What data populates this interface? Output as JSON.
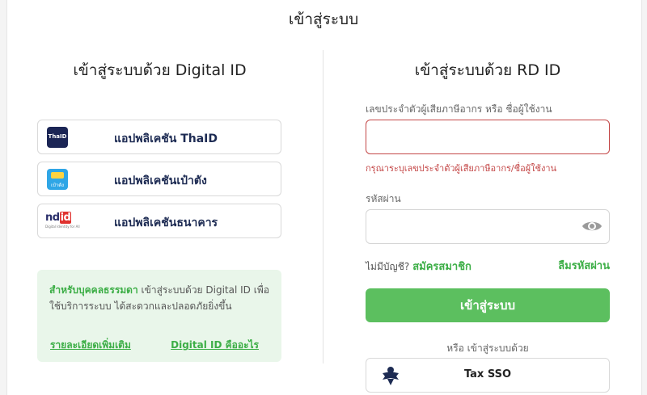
{
  "page": {
    "title": "เข้าสู่ระบบ"
  },
  "digital_id": {
    "title": "เข้าสู่ระบบด้วย Digital ID",
    "apps": [
      {
        "label": "แอปพลิเคชัน ThaID",
        "logo_text": "ThaID",
        "icon": "thaid-logo"
      },
      {
        "label": "แอปพลิเคชันเป๋าตัง",
        "logo_text": "เป๋าตัง",
        "icon": "paotang-logo"
      },
      {
        "label": "แอปพลิเคชันธนาคาร",
        "logo_text_a": "nd",
        "logo_text_b": "id",
        "logo_sub": "Digital Identity for All",
        "icon": "ndid-logo"
      }
    ],
    "info": {
      "highlight": "สำหรับบุคคลธรรมดา",
      "text": " เข้าสู่ระบบด้วย Digital ID เพื่อใช้บริการระบบ ได้สะดวกและปลอดภัยยิ่งขึ้น",
      "link_details": "รายละเอียดเพิ่มเติม",
      "link_what": "Digital ID คืออะไร"
    }
  },
  "rd_id": {
    "title": "เข้าสู่ระบบด้วย RD ID",
    "username_label": "เลขประจำตัวผู้เสียภาษีอากร หรือ ชื่อผู้ใช้งาน",
    "username_value": "",
    "username_error": "กรุณาระบุเลขประจำตัวผู้เสียภาษีอากร/ชื่อผู้ใช้งาน",
    "password_label": "รหัสผ่าน",
    "password_value": "",
    "no_account": "ไม่มีบัญชี?",
    "register": "สมัครสมาชิก",
    "forgot": "ลืมรหัสผ่าน",
    "login_button": "เข้าสู่ระบบ",
    "or_text": "หรือ เข้าสู่ระบบด้วย",
    "sso_label": "Tax SSO"
  },
  "colors": {
    "accent": "#5cbf5f",
    "link": "#3cae46",
    "error": "#c44848",
    "info_bg": "#e9f6ea",
    "navy": "#1d2b53"
  }
}
